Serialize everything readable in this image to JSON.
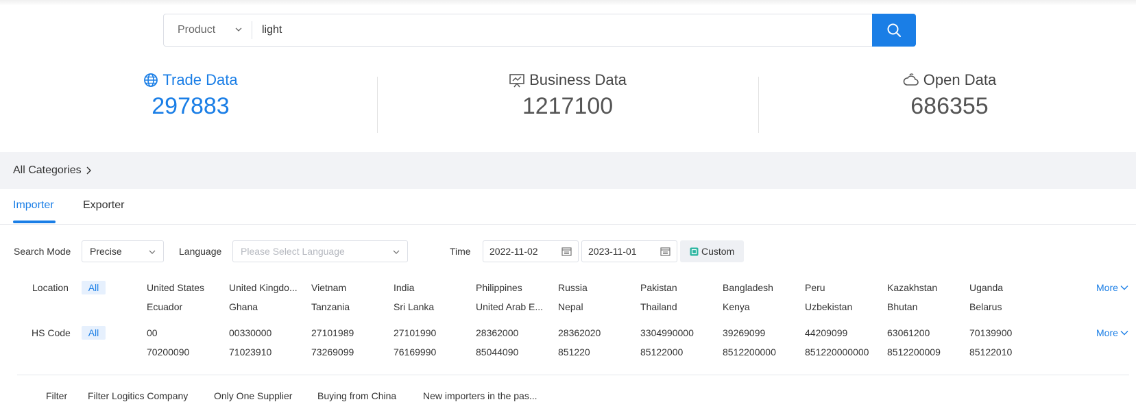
{
  "search": {
    "type_label": "Product",
    "query": "light"
  },
  "stats": {
    "trade": {
      "title": "Trade Data",
      "count": "297883"
    },
    "business": {
      "title": "Business Data",
      "count": "1217100"
    },
    "open": {
      "title": "Open Data",
      "count": "686355"
    }
  },
  "categories": {
    "label": "All Categories"
  },
  "tabs": {
    "importer": "Importer",
    "exporter": "Exporter"
  },
  "filters": {
    "search_mode_label": "Search Mode",
    "search_mode_value": "Precise",
    "language_label": "Language",
    "language_placeholder": "Please Select Language",
    "time_label": "Time",
    "date_from": "2022-11-02",
    "date_to": "2023-11-01",
    "custom_label": "Custom"
  },
  "location": {
    "label": "Location",
    "all": "All",
    "more": "More",
    "row1": [
      "United States",
      "United Kingdo...",
      "Vietnam",
      "India",
      "Philippines",
      "Russia",
      "Pakistan",
      "Bangladesh",
      "Peru",
      "Kazakhstan",
      "Uganda"
    ],
    "row2": [
      "Ecuador",
      "Ghana",
      "Tanzania",
      "Sri Lanka",
      "United Arab E...",
      "Nepal",
      "Thailand",
      "Kenya",
      "Uzbekistan",
      "Bhutan",
      "Belarus"
    ]
  },
  "hscode": {
    "label": "HS Code",
    "all": "All",
    "more": "More",
    "row1": [
      "00",
      "00330000",
      "27101989",
      "27101990",
      "28362000",
      "28362020",
      "3304990000",
      "39269099",
      "44209099",
      "63061200",
      "70139900"
    ],
    "row2": [
      "70200090",
      "71023910",
      "73269099",
      "76169990",
      "85044090",
      "851220",
      "85122000",
      "8512200000",
      "851220000000",
      "8512200009",
      "85122010"
    ]
  },
  "filter_row": {
    "label": "Filter",
    "options": [
      "Filter Logitics Company",
      "Only One Supplier",
      "Buying from China",
      "New importers in the pas..."
    ]
  },
  "colors": {
    "accent": "#1a7ee6",
    "category_bg": "#f2f3f6",
    "chip_bg": "#e6f0fd"
  }
}
